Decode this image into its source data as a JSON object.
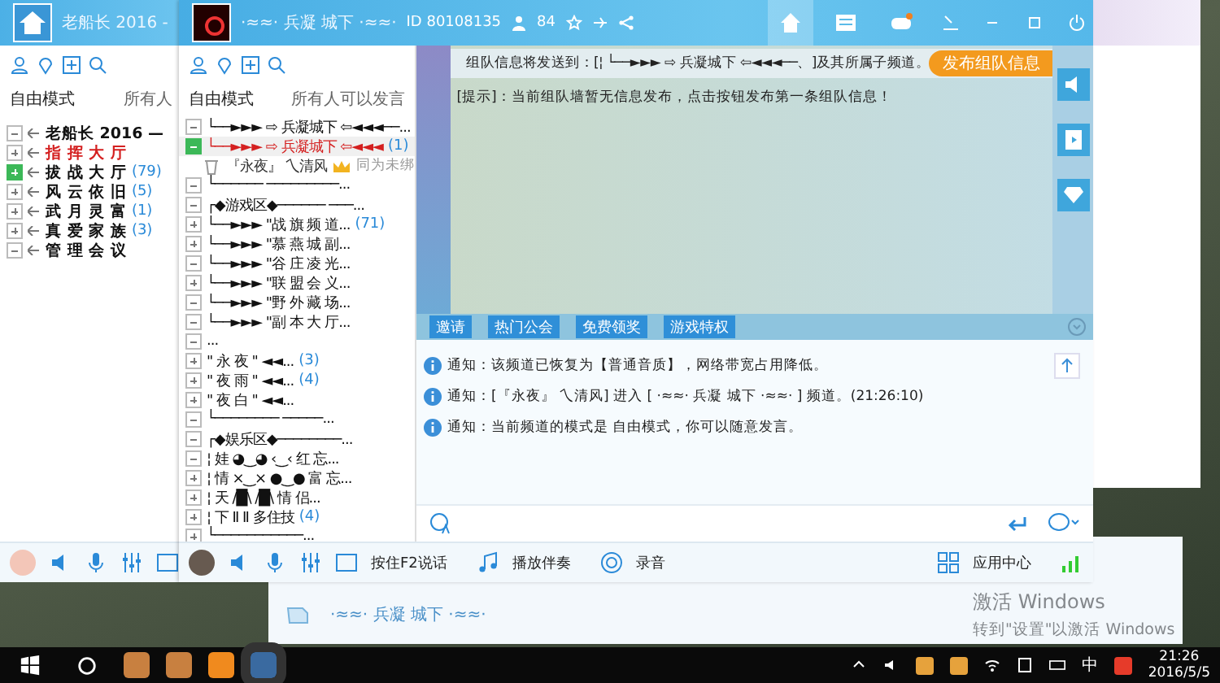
{
  "left_window": {
    "title": "老船长 2016 -",
    "mode": "自由模式",
    "mode_hint": "所有人",
    "channels": [
      {
        "label": "老船长 2016 —",
        "expanded": true,
        "selected": false,
        "color": "#111111"
      },
      {
        "label": "指 挥 大 厅",
        "expanded": false,
        "selected": false,
        "color": "#d42020"
      },
      {
        "label": "拔 战 大 厅",
        "count": "(79)",
        "expanded": false,
        "selected": true,
        "color": "#111111"
      },
      {
        "label": "风 云 依 旧",
        "count": "(5)",
        "expanded": false,
        "selected": false,
        "color": "#111111"
      },
      {
        "label": "武 月 灵 富",
        "count": "(1)",
        "expanded": false,
        "selected": false,
        "color": "#111111"
      },
      {
        "label": "真 爱 家 族",
        "count": "(3)",
        "expanded": false,
        "selected": false,
        "color": "#111111"
      },
      {
        "label": "管 理 会 议",
        "expanded": true,
        "selected": false,
        "color": "#111111"
      }
    ]
  },
  "main_window": {
    "title": "·≈≈· 兵凝 城下 ·≈≈·",
    "channel_id": "ID 80108135",
    "online": "84",
    "mode": "自由模式",
    "mode_hint": "所有人可以发言",
    "tree": [
      {
        "kind": "channel",
        "label": "└──►►► ⇨ 兵凝城下 ⇦◄◄◄──...",
        "expanded": true,
        "selected": false,
        "color": "#111111"
      },
      {
        "kind": "channel",
        "label": "└──►►► ⇨ 兵凝城下 ⇦◄◄◄",
        "count": "(1)",
        "expanded": true,
        "selected": true,
        "color": "#d42020"
      },
      {
        "kind": "user",
        "label": "『永夜』 乀清风",
        "badge": "同为未绑",
        "selected": false,
        "color": "#333333"
      },
      {
        "kind": "channel",
        "label": "└────── ─────────...",
        "expanded": true,
        "selected": false,
        "color": "#111111"
      },
      {
        "kind": "channel",
        "label": "┌◆游戏区◆────── ───...",
        "expanded": true,
        "selected": false,
        "color": "#111111"
      },
      {
        "kind": "channel",
        "label": "└──►►► \"战 旗 频 道...",
        "count": "(71)",
        "expanded": false,
        "selected": false,
        "color": "#111111"
      },
      {
        "kind": "channel",
        "label": "└──►►► \"慕 燕 城 副...",
        "expanded": false,
        "selected": false,
        "color": "#111111"
      },
      {
        "kind": "channel",
        "label": "└──►►► \"谷 庄 凌 光...",
        "expanded": true,
        "selected": false,
        "color": "#111111"
      },
      {
        "kind": "channel",
        "label": "└──►►► \"联 盟 会 义...",
        "expanded": false,
        "selected": false,
        "color": "#111111"
      },
      {
        "kind": "channel",
        "label": "└──►►► \"野 外 藏 场...",
        "expanded": true,
        "selected": false,
        "color": "#111111"
      },
      {
        "kind": "channel",
        "label": "└──►►► \"副 本 大 厅...",
        "expanded": true,
        "selected": false,
        "color": "#111111"
      },
      {
        "kind": "channel",
        "label": "...",
        "expanded": true,
        "selected": false,
        "color": "#111111"
      },
      {
        "kind": "channel",
        "label": "\" 永 夜 \" ◄◄...",
        "count": "(3)",
        "expanded": false,
        "selected": false,
        "color": "#111111"
      },
      {
        "kind": "channel",
        "label": "\" 夜 雨 \" ◄◄...",
        "count": "(4)",
        "expanded": false,
        "selected": false,
        "color": "#111111"
      },
      {
        "kind": "channel",
        "label": "\" 夜 白 \" ◄◄...",
        "expanded": false,
        "selected": false,
        "color": "#111111"
      },
      {
        "kind": "channel",
        "label": "└──────── ─────...",
        "expanded": true,
        "selected": false,
        "color": "#111111"
      },
      {
        "kind": "channel",
        "label": "┌◆娱乐区◆────────...",
        "expanded": true,
        "selected": false,
        "color": "#111111"
      },
      {
        "kind": "channel",
        "label": "¦ 娃 ◕‿◕ ‹‿‹ 红 忘...",
        "expanded": true,
        "selected": false,
        "color": "#111111"
      },
      {
        "kind": "channel",
        "label": "¦ 情 ×‿× ●‿● 富 忘...",
        "expanded": false,
        "selected": false,
        "color": "#111111"
      },
      {
        "kind": "channel",
        "label": "¦ 天 /█\\ /█\\ 情 侣...",
        "expanded": false,
        "selected": false,
        "color": "#111111"
      },
      {
        "kind": "channel",
        "label": "¦ 下 Ⅱ Ⅱ 多住技",
        "count": "(4)",
        "expanded": false,
        "selected": false,
        "color": "#111111"
      },
      {
        "kind": "channel",
        "label": "└───────────...",
        "expanded": false,
        "selected": false,
        "color": "#111111"
      }
    ],
    "team_target": "组队信息将发送到：[¦ └──►►► ⇨ 兵凝城下 ⇦◄◄◄──、]及其所属子频道。",
    "team_button": "发布组队信息",
    "hint": "[提示]：当前组队墙暂无信息发布，点击按钮发布第一条组队信息！",
    "tabs": [
      {
        "label": "邀请"
      },
      {
        "label": "热门公会"
      },
      {
        "label": "免费领奖"
      },
      {
        "label": "游戏特权"
      }
    ],
    "messages": [
      "通知：该频道已恢复为【普通音质】，网络带宽占用降低。",
      "通知：[『永夜』 乀清风] 进入 [ ·≈≈· 兵凝 城下 ·≈≈· ] 频道。(21:26:10)",
      "通知：当前频道的模式是 自由模式，你可以随意发言。"
    ],
    "toolbar": {
      "talk": "按住F2说话",
      "music": "播放伴奏",
      "record": "录音",
      "apps": "应用中心"
    }
  },
  "bottom_window": {
    "title": "·≈≈· 兵凝 城下 ·≈≈·"
  },
  "activation": {
    "title": "激活 Windows",
    "hint": "转到\"设置\"以激活 Windows"
  },
  "taskbar": {
    "ime": "中",
    "time": "21:26",
    "date": "2016/5/5"
  }
}
